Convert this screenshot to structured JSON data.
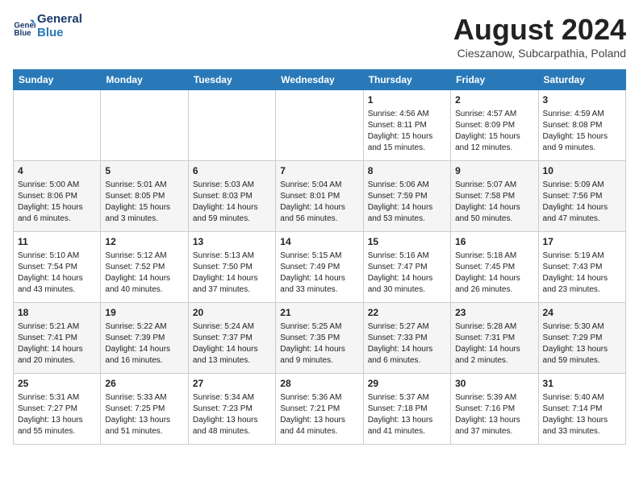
{
  "header": {
    "logo_line1": "General",
    "logo_line2": "Blue",
    "month_title": "August 2024",
    "location": "Cieszanow, Subcarpathia, Poland"
  },
  "days_of_week": [
    "Sunday",
    "Monday",
    "Tuesday",
    "Wednesday",
    "Thursday",
    "Friday",
    "Saturday"
  ],
  "weeks": [
    [
      {
        "day": "",
        "info": ""
      },
      {
        "day": "",
        "info": ""
      },
      {
        "day": "",
        "info": ""
      },
      {
        "day": "",
        "info": ""
      },
      {
        "day": "1",
        "info": "Sunrise: 4:56 AM\nSunset: 8:11 PM\nDaylight: 15 hours\nand 15 minutes."
      },
      {
        "day": "2",
        "info": "Sunrise: 4:57 AM\nSunset: 8:09 PM\nDaylight: 15 hours\nand 12 minutes."
      },
      {
        "day": "3",
        "info": "Sunrise: 4:59 AM\nSunset: 8:08 PM\nDaylight: 15 hours\nand 9 minutes."
      }
    ],
    [
      {
        "day": "4",
        "info": "Sunrise: 5:00 AM\nSunset: 8:06 PM\nDaylight: 15 hours\nand 6 minutes."
      },
      {
        "day": "5",
        "info": "Sunrise: 5:01 AM\nSunset: 8:05 PM\nDaylight: 15 hours\nand 3 minutes."
      },
      {
        "day": "6",
        "info": "Sunrise: 5:03 AM\nSunset: 8:03 PM\nDaylight: 14 hours\nand 59 minutes."
      },
      {
        "day": "7",
        "info": "Sunrise: 5:04 AM\nSunset: 8:01 PM\nDaylight: 14 hours\nand 56 minutes."
      },
      {
        "day": "8",
        "info": "Sunrise: 5:06 AM\nSunset: 7:59 PM\nDaylight: 14 hours\nand 53 minutes."
      },
      {
        "day": "9",
        "info": "Sunrise: 5:07 AM\nSunset: 7:58 PM\nDaylight: 14 hours\nand 50 minutes."
      },
      {
        "day": "10",
        "info": "Sunrise: 5:09 AM\nSunset: 7:56 PM\nDaylight: 14 hours\nand 47 minutes."
      }
    ],
    [
      {
        "day": "11",
        "info": "Sunrise: 5:10 AM\nSunset: 7:54 PM\nDaylight: 14 hours\nand 43 minutes."
      },
      {
        "day": "12",
        "info": "Sunrise: 5:12 AM\nSunset: 7:52 PM\nDaylight: 14 hours\nand 40 minutes."
      },
      {
        "day": "13",
        "info": "Sunrise: 5:13 AM\nSunset: 7:50 PM\nDaylight: 14 hours\nand 37 minutes."
      },
      {
        "day": "14",
        "info": "Sunrise: 5:15 AM\nSunset: 7:49 PM\nDaylight: 14 hours\nand 33 minutes."
      },
      {
        "day": "15",
        "info": "Sunrise: 5:16 AM\nSunset: 7:47 PM\nDaylight: 14 hours\nand 30 minutes."
      },
      {
        "day": "16",
        "info": "Sunrise: 5:18 AM\nSunset: 7:45 PM\nDaylight: 14 hours\nand 26 minutes."
      },
      {
        "day": "17",
        "info": "Sunrise: 5:19 AM\nSunset: 7:43 PM\nDaylight: 14 hours\nand 23 minutes."
      }
    ],
    [
      {
        "day": "18",
        "info": "Sunrise: 5:21 AM\nSunset: 7:41 PM\nDaylight: 14 hours\nand 20 minutes."
      },
      {
        "day": "19",
        "info": "Sunrise: 5:22 AM\nSunset: 7:39 PM\nDaylight: 14 hours\nand 16 minutes."
      },
      {
        "day": "20",
        "info": "Sunrise: 5:24 AM\nSunset: 7:37 PM\nDaylight: 14 hours\nand 13 minutes."
      },
      {
        "day": "21",
        "info": "Sunrise: 5:25 AM\nSunset: 7:35 PM\nDaylight: 14 hours\nand 9 minutes."
      },
      {
        "day": "22",
        "info": "Sunrise: 5:27 AM\nSunset: 7:33 PM\nDaylight: 14 hours\nand 6 minutes."
      },
      {
        "day": "23",
        "info": "Sunrise: 5:28 AM\nSunset: 7:31 PM\nDaylight: 14 hours\nand 2 minutes."
      },
      {
        "day": "24",
        "info": "Sunrise: 5:30 AM\nSunset: 7:29 PM\nDaylight: 13 hours\nand 59 minutes."
      }
    ],
    [
      {
        "day": "25",
        "info": "Sunrise: 5:31 AM\nSunset: 7:27 PM\nDaylight: 13 hours\nand 55 minutes."
      },
      {
        "day": "26",
        "info": "Sunrise: 5:33 AM\nSunset: 7:25 PM\nDaylight: 13 hours\nand 51 minutes."
      },
      {
        "day": "27",
        "info": "Sunrise: 5:34 AM\nSunset: 7:23 PM\nDaylight: 13 hours\nand 48 minutes."
      },
      {
        "day": "28",
        "info": "Sunrise: 5:36 AM\nSunset: 7:21 PM\nDaylight: 13 hours\nand 44 minutes."
      },
      {
        "day": "29",
        "info": "Sunrise: 5:37 AM\nSunset: 7:18 PM\nDaylight: 13 hours\nand 41 minutes."
      },
      {
        "day": "30",
        "info": "Sunrise: 5:39 AM\nSunset: 7:16 PM\nDaylight: 13 hours\nand 37 minutes."
      },
      {
        "day": "31",
        "info": "Sunrise: 5:40 AM\nSunset: 7:14 PM\nDaylight: 13 hours\nand 33 minutes."
      }
    ]
  ]
}
